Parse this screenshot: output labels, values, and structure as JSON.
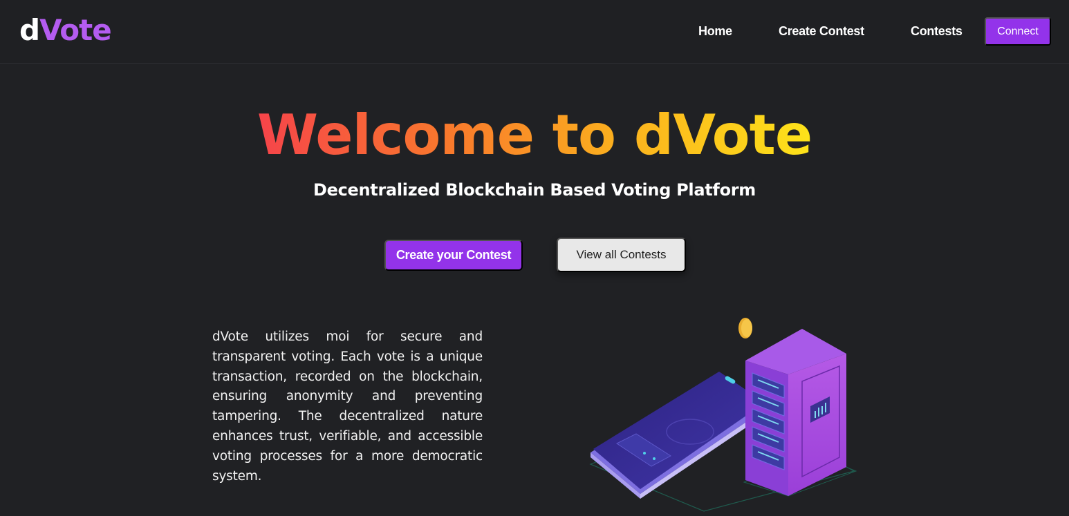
{
  "navbar": {
    "logo_prefix": "d",
    "logo_suffix": "Vote",
    "links": [
      "Home",
      "Create Contest",
      "Contests"
    ],
    "connect_label": "Connect"
  },
  "hero": {
    "title": "Welcome to dVote",
    "subtitle": "Decentralized Blockchain Based Voting Platform",
    "primary_button": "Create your Contest",
    "secondary_button": "View all Contests"
  },
  "about": {
    "description": "dVote utilizes moi for secure and transparent voting. Each vote is a unique transaction, recorded on the blockchain, ensuring anonymity and preventing tampering. The decentralized nature enhances trust, verifiable, and accessible voting processes for a more democratic system."
  },
  "illustration": {
    "icon": "blockchain-server-phone-illustration"
  },
  "colors": {
    "background": "#202124",
    "accent_purple": "#9333ea",
    "logo_purple": "#b45cf0",
    "title_gradient": [
      "#f6444a",
      "#f97a2c",
      "#fbb01e",
      "#fde31a"
    ],
    "secondary_button_bg": "#e8e8e8"
  }
}
